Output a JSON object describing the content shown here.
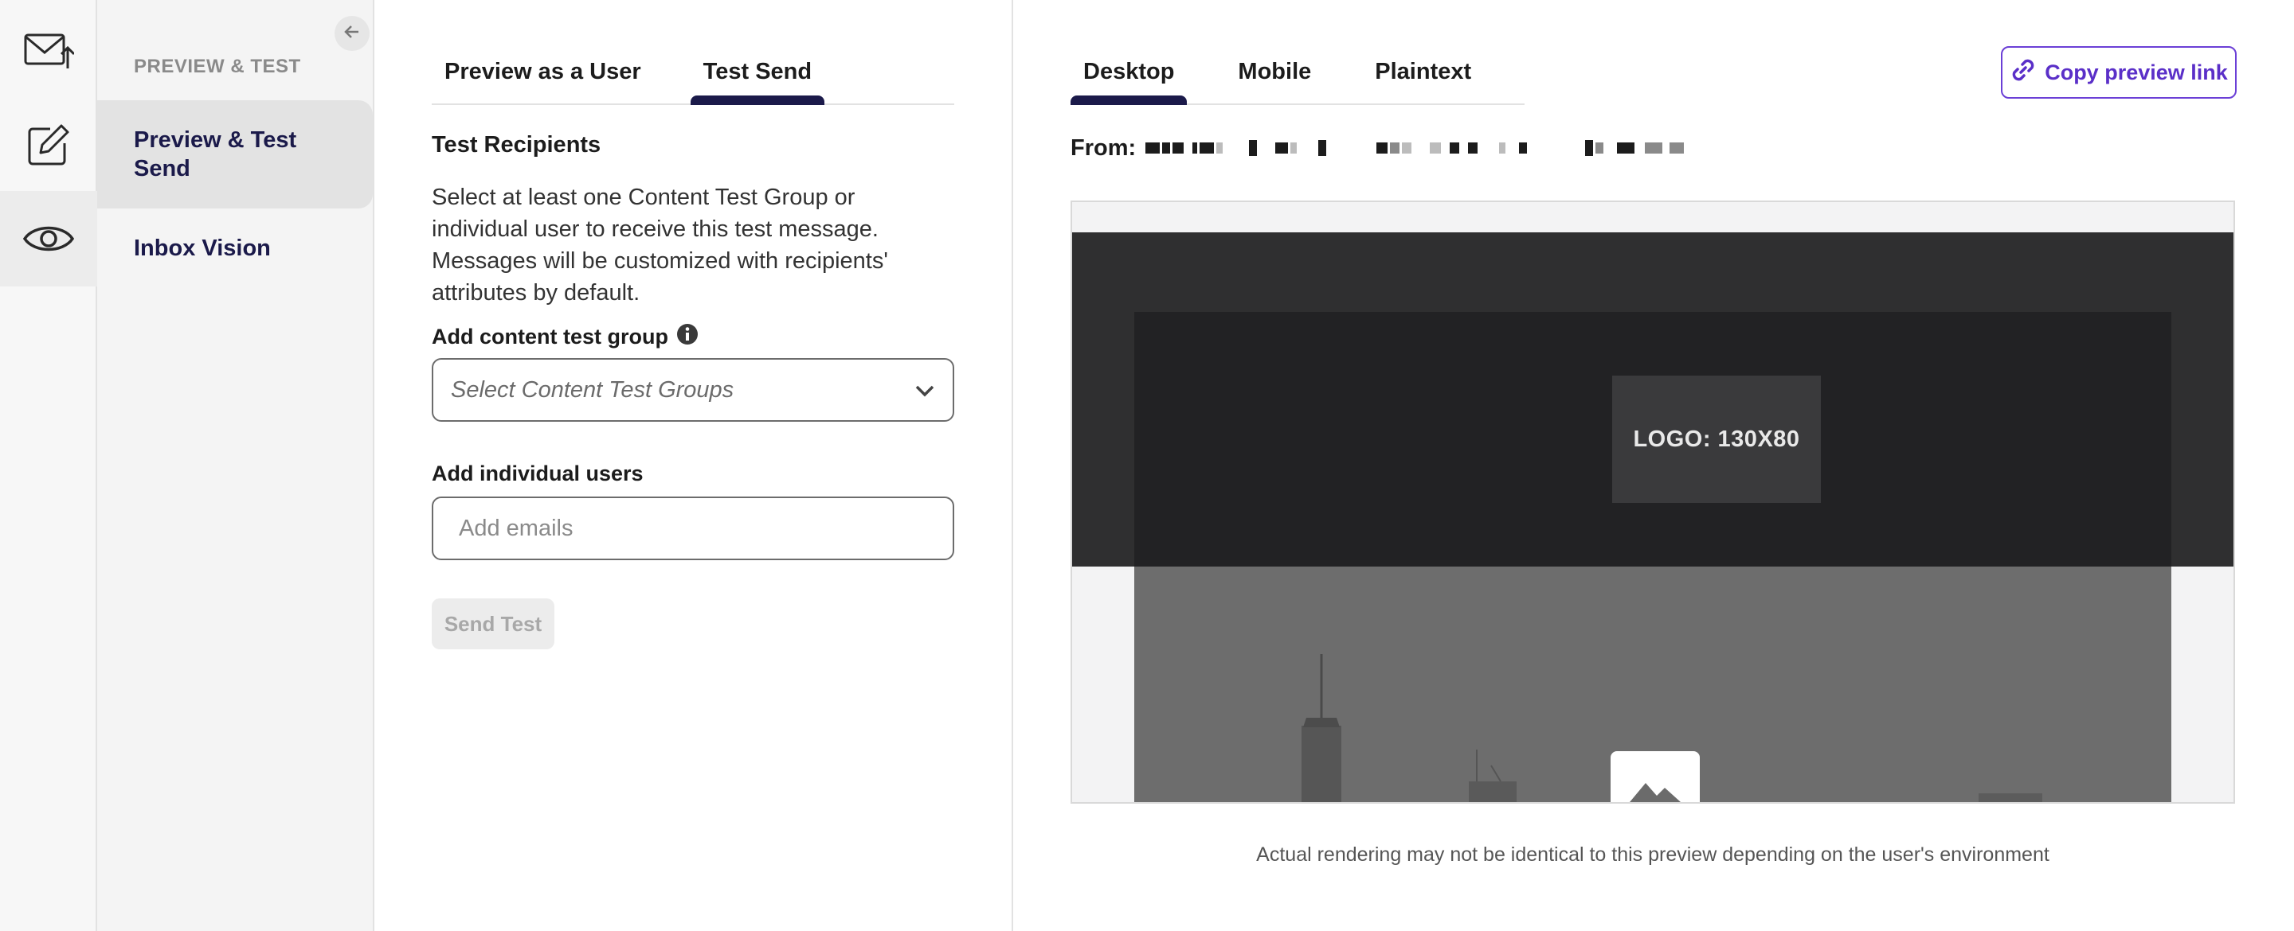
{
  "rail": {
    "items": [
      {
        "icon": "mail-upload-icon"
      },
      {
        "icon": "edit-icon"
      },
      {
        "icon": "eye-icon"
      }
    ]
  },
  "subnav": {
    "heading": "PREVIEW & TEST",
    "items": [
      {
        "label": "Preview & Test Send"
      },
      {
        "label": "Inbox Vision"
      }
    ]
  },
  "left_tabs": [
    {
      "label": "Preview as a User"
    },
    {
      "label": "Test Send"
    }
  ],
  "test_send": {
    "title": "Test Recipients",
    "description": "Select at least one Content Test Group or individual user to receive this test message. Messages will be customized with recipients' attributes by default.",
    "group_label": "Add content test group",
    "group_placeholder": "Select Content Test Groups",
    "users_label": "Add individual users",
    "users_placeholder": "Add emails",
    "send_button": "Send Test"
  },
  "preview": {
    "tabs": [
      {
        "label": "Desktop"
      },
      {
        "label": "Mobile"
      },
      {
        "label": "Plaintext"
      }
    ],
    "copy_link_label": "Copy preview link",
    "from_label": "From:",
    "logo_text": "LOGO: 130X80",
    "disclaimer": "Actual rendering may not be identical to this preview depending on the user's environment"
  },
  "colors": {
    "brand_dark": "#1b1a4a",
    "link_purple": "#5a2fc8"
  }
}
